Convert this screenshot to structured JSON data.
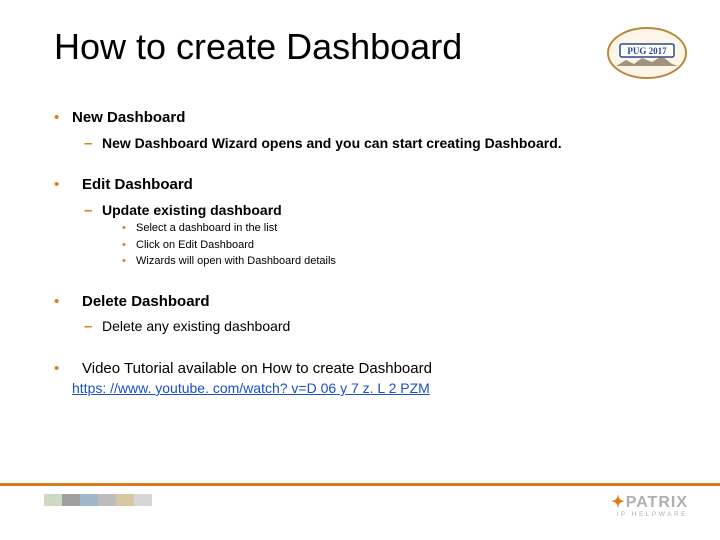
{
  "title": "How to create Dashboard",
  "logo": {
    "badge_text": "PUG 2017"
  },
  "sections": [
    {
      "heading": "New Dashboard",
      "subs": [
        {
          "text": "New Dashboard Wizard opens and you can start creating Dashboard."
        }
      ]
    },
    {
      "heading": "Edit Dashboard",
      "subs": [
        {
          "text": "Update existing dashboard",
          "items": [
            "Select a dashboard in the list",
            "Click on Edit Dashboard",
            "Wizards will open with Dashboard details"
          ]
        }
      ]
    },
    {
      "heading": "Delete Dashboard",
      "subs": [
        {
          "text": "Delete any existing dashboard"
        }
      ]
    },
    {
      "heading": "Video Tutorial available on How to create Dashboard",
      "link": "https: //www. youtube. com/watch? v=D 06 y 7 z. L 2 PZM"
    }
  ],
  "footer": {
    "block_colors": [
      "#cfd8c2",
      "#9f9f9f",
      "#9fb7c9",
      "#bcbcbc",
      "#d9c7a3",
      "#d6d6d6"
    ],
    "brand": "PATRIX",
    "tagline": "IP HELPWARE"
  }
}
